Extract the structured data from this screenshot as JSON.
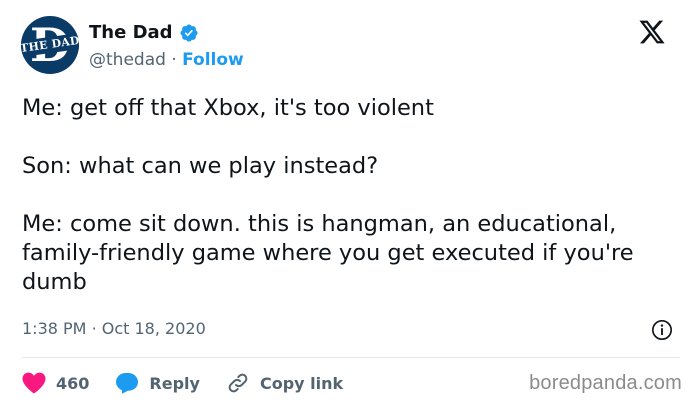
{
  "header": {
    "avatar_text": "THE DAD",
    "display_name": "The Dad",
    "handle": "@thedad",
    "separator": "·",
    "follow_label": "Follow"
  },
  "tweet": {
    "paragraphs": [
      "Me: get off that Xbox, it's too violent",
      "Son: what can we play instead?",
      "Me: come sit down. this is hangman, an educational, family-friendly game where you get executed if you're dumb"
    ],
    "time": "1:38 PM",
    "date": "Oct 18, 2020",
    "time_separator": "·"
  },
  "actions": {
    "like_count": "460",
    "reply_label": "Reply",
    "copy_link_label": "Copy link"
  },
  "watermark": "boredpanda.com",
  "colors": {
    "accent": "#1d9bf0",
    "like": "#f91880",
    "muted": "#536471",
    "text": "#0f1419"
  },
  "icons": [
    "verified-badge-icon",
    "x-logo-icon",
    "info-icon",
    "heart-icon",
    "reply-bubble-icon",
    "link-icon"
  ]
}
